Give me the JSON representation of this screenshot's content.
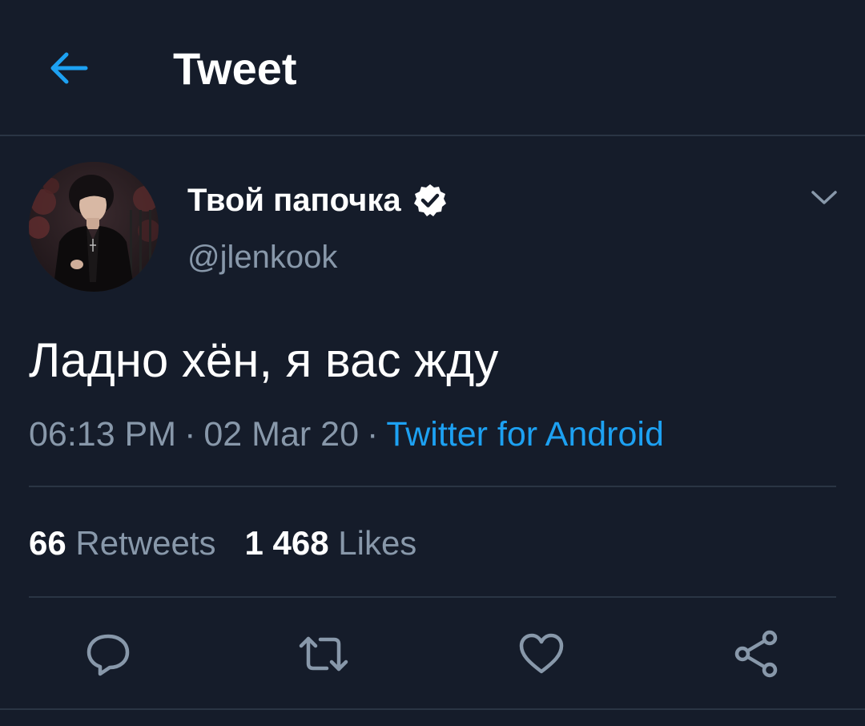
{
  "header": {
    "title": "Tweet",
    "back_icon": "arrow-left-icon"
  },
  "tweet": {
    "display_name": "Твой папочка",
    "verified": true,
    "handle": "@jlenkook",
    "text": "Ладно хён, я вас жду",
    "time": "06:13 PM",
    "date": "02 Mar 20",
    "separator": "·",
    "source": "Twitter for Android",
    "retweets_count": "66",
    "retweets_label": "Retweets",
    "likes_count": "1 468",
    "likes_label": "Likes"
  },
  "actions": [
    "reply-icon",
    "retweet-icon",
    "like-icon",
    "share-icon"
  ],
  "colors": {
    "background": "#151c2a",
    "accent": "#1da1f2",
    "secondary_text": "#8898aa",
    "divider": "#2a3544",
    "primary_text": "#ffffff"
  }
}
